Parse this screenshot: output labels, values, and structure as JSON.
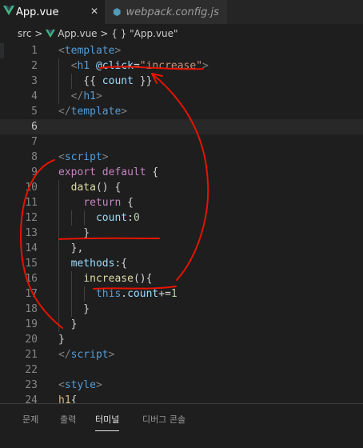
{
  "tabs": [
    {
      "label": "App.vue",
      "close": "✕"
    },
    {
      "label": "webpack.config.js"
    }
  ],
  "breadcrumb": {
    "folder": "src",
    "sep1": " > ",
    "file": "App.vue",
    "sep2": " > ",
    "symbol": "{ } \"App.vue\""
  },
  "code_lines": [
    {
      "num": "1"
    },
    {
      "num": "2"
    },
    {
      "num": "3"
    },
    {
      "num": "4"
    },
    {
      "num": "5"
    },
    {
      "num": "6"
    },
    {
      "num": "7"
    },
    {
      "num": "8"
    },
    {
      "num": "9"
    },
    {
      "num": "10"
    },
    {
      "num": "11"
    },
    {
      "num": "12"
    },
    {
      "num": "13"
    },
    {
      "num": "14"
    },
    {
      "num": "15"
    },
    {
      "num": "16"
    },
    {
      "num": "17"
    },
    {
      "num": "18"
    },
    {
      "num": "19"
    },
    {
      "num": "20"
    },
    {
      "num": "21"
    },
    {
      "num": "22"
    },
    {
      "num": "23"
    },
    {
      "num": "24"
    }
  ],
  "panel_tabs": [
    {
      "label": "문제"
    },
    {
      "label": "출력"
    },
    {
      "label": "터미널"
    },
    {
      "label": "디버그 콘솔"
    }
  ],
  "colors": {
    "annotation": "#e51400",
    "vue_green": "#41b883"
  },
  "icons": {
    "file_icon": "vue-icon",
    "config_icon": "settings-icon"
  }
}
